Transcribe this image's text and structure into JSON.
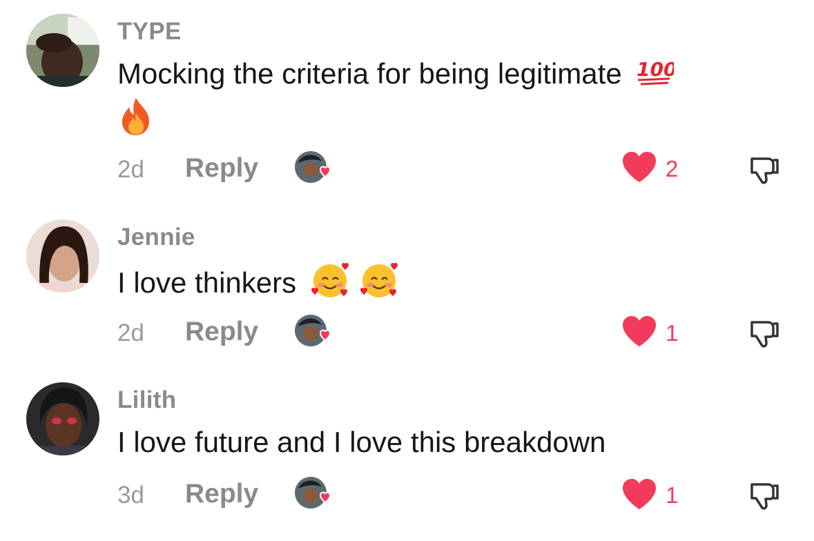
{
  "comments": [
    {
      "username": "TYPE",
      "text": "Mocking the criteria for being legitimate",
      "emojis": [
        "hundred-points-emoji",
        "fire-emoji"
      ],
      "time": "2d",
      "reply_label": "Reply",
      "likes": "2"
    },
    {
      "username": "Jennie",
      "text": "I love thinkers",
      "emojis": [
        "smiling-face-with-hearts-emoji",
        "smiling-face-with-hearts-emoji"
      ],
      "time": "2d",
      "reply_label": "Reply",
      "likes": "1"
    },
    {
      "username": "Lilith",
      "text": "I love future and I love this breakdown",
      "emojis": [],
      "time": "3d",
      "reply_label": "Reply",
      "likes": "1"
    }
  ],
  "colors": {
    "like": "#f23a5a",
    "username": "#8a8a8a",
    "text": "#161616",
    "meta": "#9a9a9a"
  },
  "icons": [
    "heart-icon",
    "dislike-icon",
    "creator-liked-avatar"
  ]
}
